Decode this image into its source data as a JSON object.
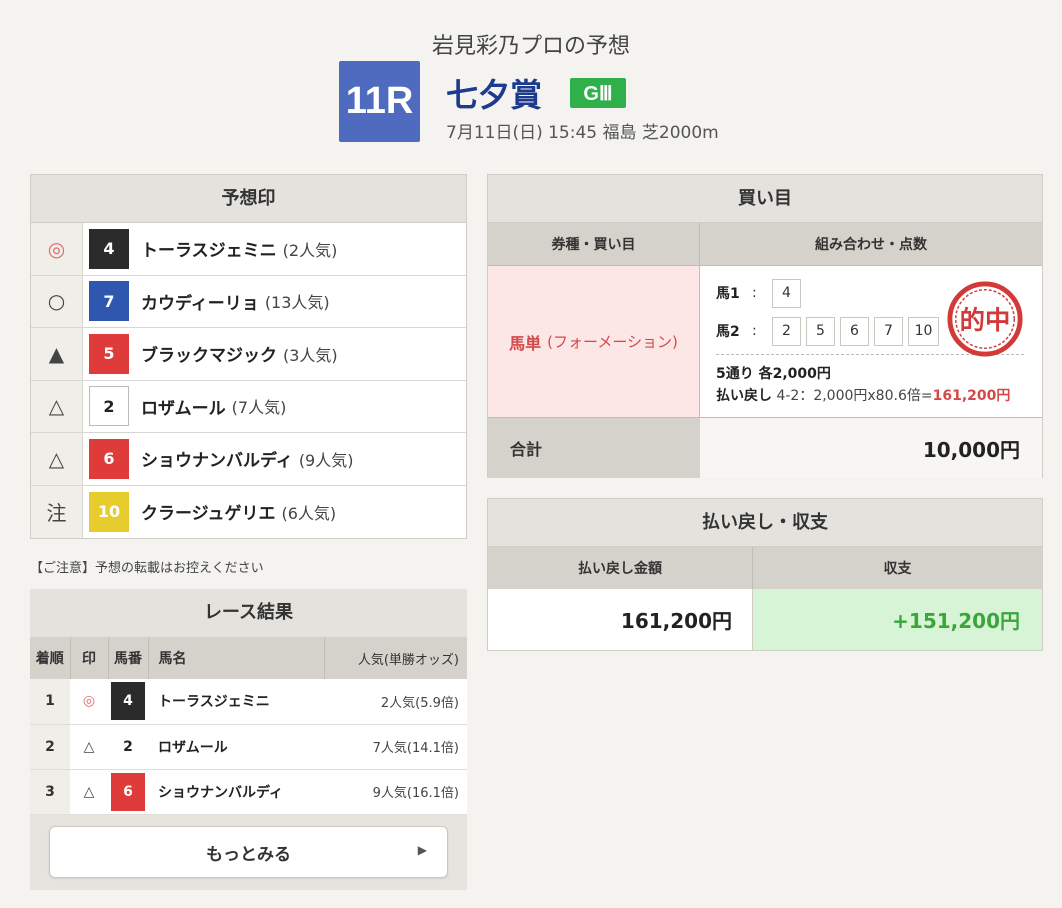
{
  "header": {
    "title": "岩見彩乃プロの予想",
    "race_number": "11R",
    "race_name": "七夕賞",
    "grade": "GⅢ",
    "info": "7月11日(日) 15:45 福島 芝2000m"
  },
  "colors": {
    "race_badge": "#4f6bbf",
    "race_name": "#1d3b8e",
    "grade_badge": "#2fb04a",
    "hit_red": "#d54848",
    "balance_green": "#3aa63a"
  },
  "predictions": {
    "title": "予想印",
    "rows": [
      {
        "mark": "◎",
        "num": "4",
        "color": "black",
        "name": "トーラスジェミニ",
        "pop": "(2人気)"
      },
      {
        "mark": "○",
        "num": "7",
        "color": "blue",
        "name": "カウディーリョ",
        "pop": "(13人気)"
      },
      {
        "mark": "▲",
        "num": "5",
        "color": "red",
        "name": "ブラックマジック",
        "pop": "(3人気)"
      },
      {
        "mark": "△",
        "num": "2",
        "color": "white",
        "name": "ロザムール",
        "pop": "(7人気)"
      },
      {
        "mark": "△",
        "num": "6",
        "color": "red",
        "name": "ショウナンバルディ",
        "pop": "(9人気)"
      },
      {
        "mark": "注",
        "num": "10",
        "color": "yellow",
        "name": "クラージュゲリエ",
        "pop": "(6人気)"
      }
    ]
  },
  "notice": "【ご注意】予想の転載はお控えください",
  "results": {
    "title": "レース結果",
    "headers": [
      "着順",
      "印",
      "馬番",
      "馬名",
      "人気(単勝オッズ)"
    ],
    "rows": [
      {
        "rank": "1",
        "mark": "◎",
        "num": "4",
        "color": "black",
        "name": "トーラスジェミニ",
        "pop": "2人気(5.9倍)"
      },
      {
        "rank": "2",
        "mark": "△",
        "num": "2",
        "color": "white",
        "name": "ロザムール",
        "pop": "7人気(14.1倍)"
      },
      {
        "rank": "3",
        "mark": "△",
        "num": "6",
        "color": "red",
        "name": "ショウナンバルディ",
        "pop": "9人気(16.1倍)"
      }
    ],
    "more_label": "もっとみる"
  },
  "bets": {
    "title": "買い目",
    "col1": "券種・買い目",
    "col2": "組み合わせ・点数",
    "type_main": "馬単",
    "type_sub": "(フォーメーション)",
    "horse1_label": "馬1",
    "horse1": [
      "4"
    ],
    "horse2_label": "馬2",
    "horse2": [
      "2",
      "5",
      "6",
      "7",
      "10"
    ],
    "count": "5通り 各2,000円",
    "payout_label": "払い戻し",
    "payout_text": "4-2：2,000円x80.6倍=",
    "payout_value": "161,200円",
    "stamp_text": "的中",
    "total_label": "合計",
    "total_value": "10,000円"
  },
  "payout": {
    "title": "払い戻し・収支",
    "amount_label": "払い戻し金額",
    "balance_label": "収支",
    "amount": "161,200円",
    "balance": "+151,200円"
  }
}
